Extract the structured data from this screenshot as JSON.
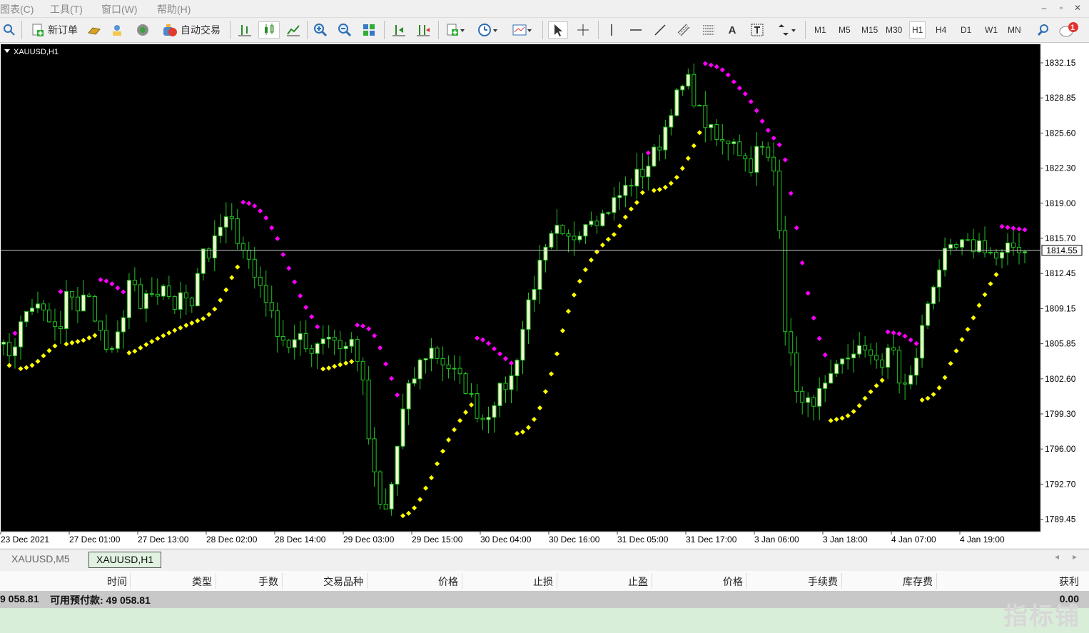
{
  "menu": {
    "items": [
      "图表(C)",
      "工具(T)",
      "窗口(W)",
      "帮助(H)"
    ]
  },
  "window_controls": {
    "minimize": "–",
    "restore": "▫",
    "close": "✕"
  },
  "toolbar": {
    "new_order_label": "新订单",
    "auto_trading_label": "自动交易",
    "timeframes": [
      "M1",
      "M5",
      "M15",
      "M30",
      "H1",
      "H4",
      "D1",
      "W1",
      "MN"
    ],
    "active_timeframe": "H1",
    "text_tool": "A",
    "notification_count": "1"
  },
  "chart": {
    "symbol_label": "XAUUSD,H1",
    "current_price": "1814.55",
    "price_labels": [
      "1832.15",
      "1828.85",
      "1825.60",
      "1822.30",
      "1819.00",
      "1815.70",
      "1812.45",
      "1809.15",
      "1805.85",
      "1802.60",
      "1799.30",
      "1796.00",
      "1792.70",
      "1789.45"
    ],
    "time_labels": [
      "23 Dec 2021",
      "27 Dec 01:00",
      "27 Dec 13:00",
      "28 Dec 02:00",
      "28 Dec 14:00",
      "29 Dec 03:00",
      "29 Dec 15:00",
      "30 Dec 04:00",
      "30 Dec 16:00",
      "31 Dec 05:00",
      "31 Dec 17:00",
      "3 Jan 06:00",
      "3 Jan 18:00",
      "4 Jan 07:00",
      "4 Jan 19:00"
    ],
    "colors": {
      "background": "#000000",
      "bull_candle": "#f2f7d0",
      "wick": "#22c422",
      "sar_below": "#ffff00",
      "sar_above": "#ff00ff",
      "price_line": "#c8c8c8"
    }
  },
  "chart_data": {
    "type": "candlestick",
    "ylim": [
      1788.0,
      1834.0
    ],
    "price_path": [
      1806.5,
      1804.5,
      1806,
      1808.5,
      1809.5,
      1808.7,
      1807.5,
      1806.5,
      1811.5,
      1809,
      1810.5,
      1808.5,
      1805.5,
      1804.5,
      1808,
      1812.5,
      1808.5,
      1810.8,
      1809.5,
      1811,
      1809.2,
      1810.5,
      1809.8,
      1815,
      1814,
      1816.5,
      1817.6,
      1816,
      1814.5,
      1812,
      1811,
      1808,
      1806.5,
      1805.5,
      1806.2,
      1805,
      1805.8,
      1806.8,
      1806.2,
      1805.2,
      1806,
      1803.5,
      1796,
      1790.5,
      1789.8,
      1795.5,
      1800.5,
      1802.5,
      1804.5,
      1805.2,
      1804.2,
      1803.5,
      1802.5,
      1801.5,
      1799.5,
      1798.5,
      1800.5,
      1801.5,
      1802.5,
      1806,
      1810,
      1812.5,
      1814.5,
      1816.5,
      1815.2,
      1815.8,
      1817,
      1818,
      1817.5,
      1818.6,
      1819.5,
      1820.5,
      1821.5,
      1822,
      1823.5,
      1825,
      1828,
      1829.5,
      1830.5,
      1828,
      1826.5,
      1825,
      1824.5,
      1825.5,
      1823.5,
      1822.5,
      1824.5,
      1823,
      1821.5,
      1806.5,
      1802.5,
      1799.5,
      1800.5,
      1801,
      1802,
      1803.5,
      1804.5,
      1805.5,
      1804.5,
      1805,
      1803.5,
      1805.8,
      1801.5,
      1802,
      1805.5,
      1809.5,
      1812.5,
      1814,
      1814.5,
      1815,
      1814.8,
      1815.3,
      1814.5,
      1813.5,
      1814.5,
      1815,
      1814.5
    ]
  },
  "tabs": [
    {
      "label": "XAUUSD,M5",
      "active": false
    },
    {
      "label": "XAUUSD,H1",
      "active": true
    }
  ],
  "terminal": {
    "columns": [
      "时间",
      "类型",
      "手数",
      "交易品种",
      "价格",
      "止损",
      "止盈",
      "价格",
      "手续费",
      "库存费",
      "获利"
    ],
    "balance_label": "9 058.81",
    "free_margin_label": "可用预付款: 49 058.81",
    "profit_value": "0.00"
  },
  "watermark": "指标铺"
}
